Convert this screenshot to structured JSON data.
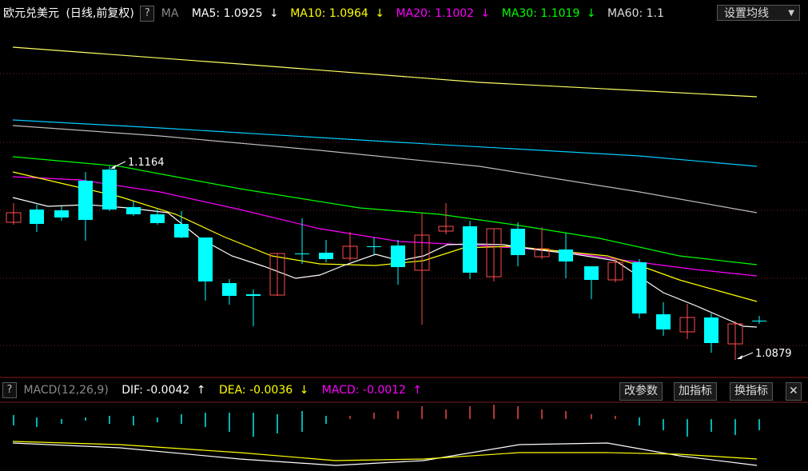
{
  "header": {
    "title": "欧元兑美元",
    "period": "(日线,前复权)",
    "help": "?",
    "ma_label": "MA",
    "ma": [
      {
        "label": "MA5: 1.0925",
        "arrow": "↓",
        "color": "#ffffff"
      },
      {
        "label": "MA10: 1.0964",
        "arrow": "↓",
        "color": "#ffff00"
      },
      {
        "label": "MA20: 1.1002",
        "arrow": "↓",
        "color": "#ff00ff"
      },
      {
        "label": "MA30: 1.1019",
        "arrow": "↓",
        "color": "#00ff00"
      },
      {
        "label": "MA60: 1.1",
        "arrow": "",
        "color": "#dddddd"
      }
    ],
    "settings_label": "设置均线",
    "settings_arrow": "▼"
  },
  "annotations": {
    "high": "1.1164",
    "low": "1.0879"
  },
  "indicator": {
    "help": "?",
    "name": "MACD(12,26,9)",
    "dif": "DIF: -0.0042",
    "dif_arrow": "↑",
    "dea": "DEA: -0.0036",
    "dea_arrow": "↓",
    "macd": "MACD: -0.0012",
    "macd_arrow": "↑",
    "buttons": [
      "改参数",
      "加指标",
      "换指标"
    ],
    "close": "✕"
  },
  "colors": {
    "up": "#ff4d4d",
    "down": "#00ffff",
    "ma5": "#ffffff",
    "ma10": "#ffff00",
    "ma20": "#ff00ff",
    "ma30": "#00ff00",
    "ma60": "#bbbbbb",
    "ma120": "#00ccff",
    "ma250": "#ffff66"
  }
}
